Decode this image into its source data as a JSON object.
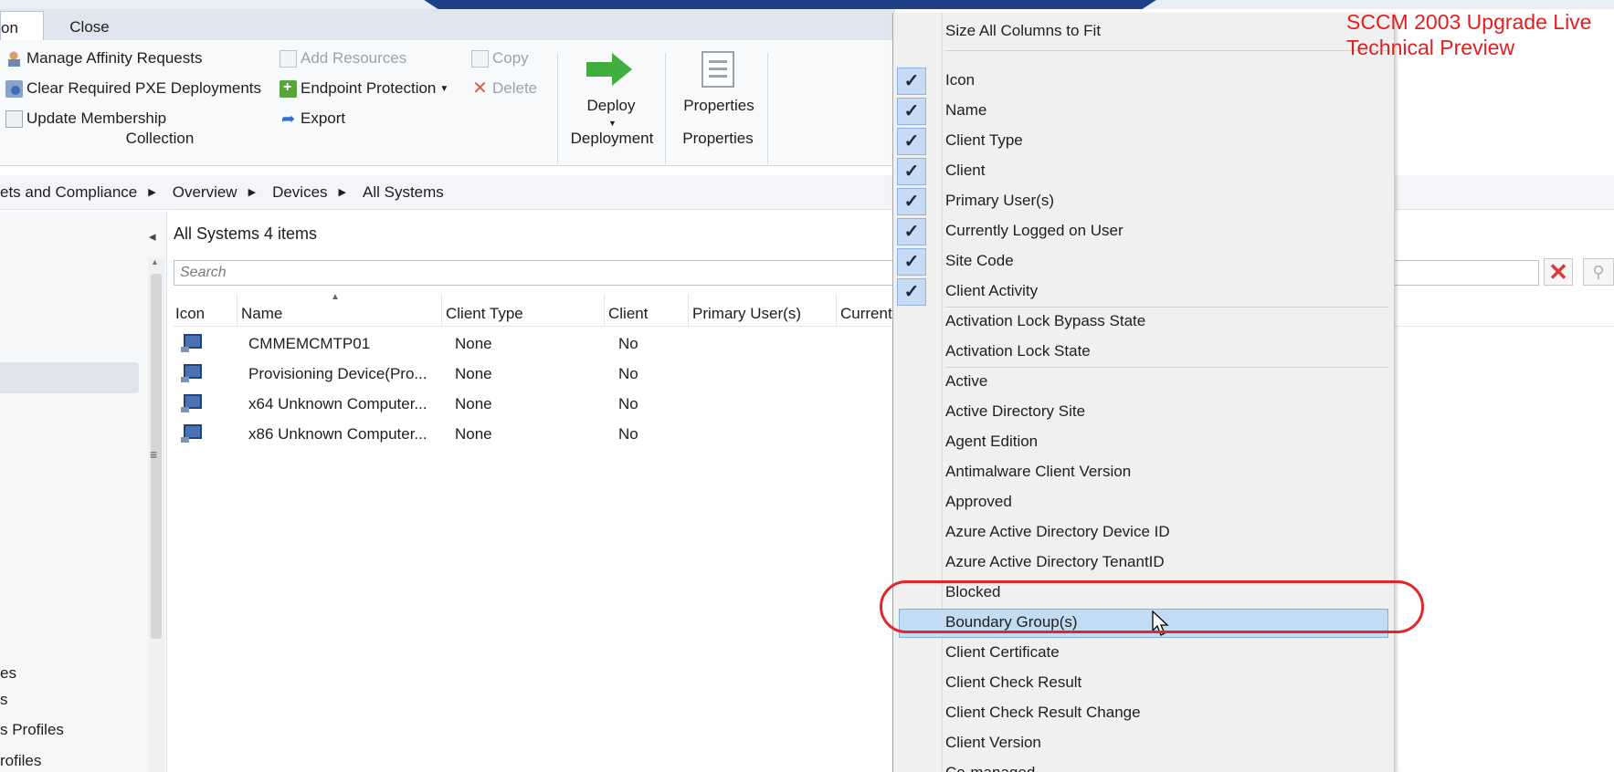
{
  "ribbon": {
    "tabs": {
      "home_partial": "on",
      "close": "Close"
    },
    "buttons": {
      "manage_affinity": "Manage Affinity Requests",
      "clear_pxe": "Clear Required PXE Deployments",
      "update_membership": "Update Membership",
      "add_resources": "Add Resources",
      "endpoint_protection": "Endpoint Protection",
      "export": "Export",
      "copy": "Copy",
      "delete": "Delete",
      "deploy": "Deploy",
      "properties": "Properties"
    },
    "groups": {
      "collection": "Collection",
      "deployment": "Deployment",
      "properties": "Properties"
    }
  },
  "breadcrumb": [
    "ets and Compliance",
    "Overview",
    "Devices",
    "All Systems"
  ],
  "nav": {
    "items": [
      "es",
      "s",
      "s Profiles",
      "rofiles"
    ]
  },
  "main": {
    "title": "All Systems 4 items",
    "search_placeholder": "Search",
    "columns": [
      "Icon",
      "Name",
      "Client Type",
      "Client",
      "Primary User(s)",
      "Current"
    ],
    "rows": [
      {
        "name": "CMMEMCMTP01",
        "client_type": "None",
        "client": "No"
      },
      {
        "name": "Provisioning Device(Pro...",
        "client_type": "None",
        "client": "No"
      },
      {
        "name": "x64 Unknown Computer...",
        "client_type": "None",
        "client": "No"
      },
      {
        "name": "x86 Unknown Computer...",
        "client_type": "None",
        "client": "No"
      }
    ]
  },
  "context_menu": {
    "top_item": "Size All Columns to Fit",
    "items": [
      {
        "label": "Icon",
        "checked": true
      },
      {
        "label": "Name",
        "checked": true
      },
      {
        "label": "Client Type",
        "checked": true
      },
      {
        "label": "Client",
        "checked": true
      },
      {
        "label": "Primary User(s)",
        "checked": true
      },
      {
        "label": "Currently Logged on User",
        "checked": true
      },
      {
        "label": "Site Code",
        "checked": true
      },
      {
        "label": "Client Activity",
        "checked": true
      },
      {
        "label": "Activation Lock Bypass State",
        "checked": false
      },
      {
        "label": "Activation Lock State",
        "checked": false
      },
      {
        "label": "Active",
        "checked": false
      },
      {
        "label": "Active Directory Site",
        "checked": false
      },
      {
        "label": "Agent Edition",
        "checked": false
      },
      {
        "label": "Antimalware Client Version",
        "checked": false
      },
      {
        "label": "Approved",
        "checked": false
      },
      {
        "label": "Azure Active Directory Device ID",
        "checked": false
      },
      {
        "label": "Azure Active Directory TenantID",
        "checked": false
      },
      {
        "label": "Blocked",
        "checked": false
      },
      {
        "label": "Boundary Group(s)",
        "checked": false,
        "highlighted": true
      },
      {
        "label": "Client Certificate",
        "checked": false
      },
      {
        "label": "Client Check Result",
        "checked": false
      },
      {
        "label": "Client Check Result Change",
        "checked": false
      },
      {
        "label": "Client Version",
        "checked": false
      },
      {
        "label": "Co-managed",
        "checked": false
      }
    ]
  },
  "overlay": {
    "line1": "SCCM 2003 Upgrade Live",
    "line2": "Technical Preview",
    "color": "#e02020"
  },
  "colors": {
    "accent_blue": "#1f3f86",
    "check_bg": "#c7dcf4",
    "highlight": "#c2dcf3",
    "annotation_red": "#e2272a"
  }
}
